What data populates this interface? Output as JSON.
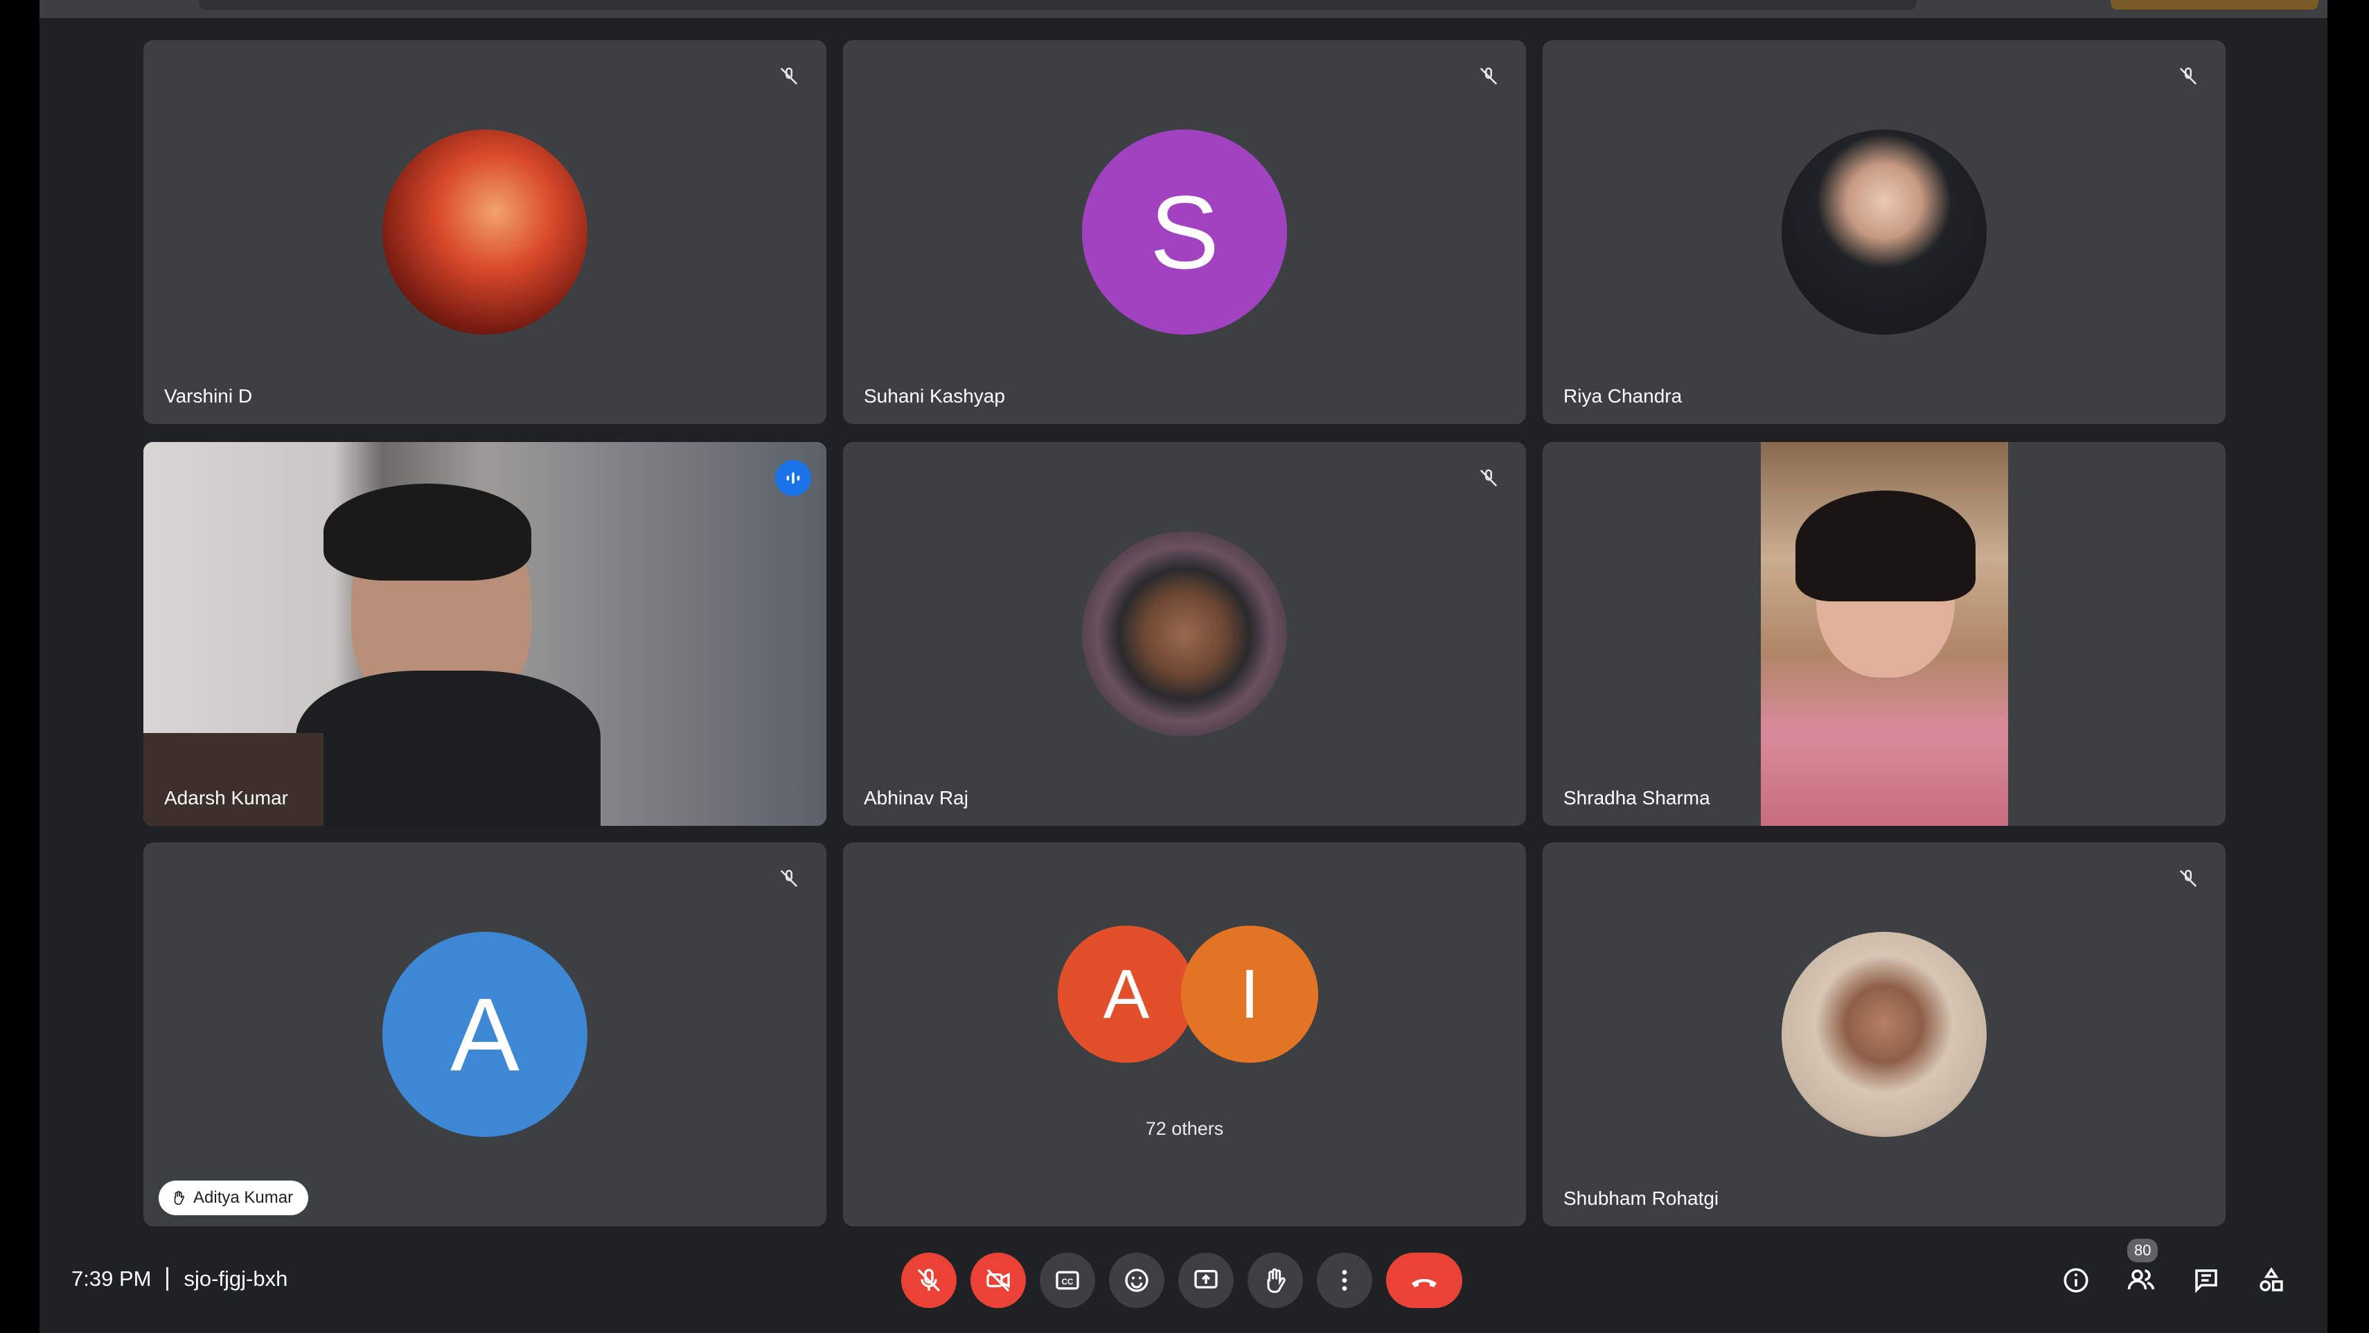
{
  "meeting": {
    "time": "7:39 PM",
    "code": "sjo-fjgj-bxh",
    "participant_count": "80"
  },
  "tiles": [
    {
      "name": "Varshini D",
      "avatar_type": "photo",
      "muted": true
    },
    {
      "name": "Suhani Kashyap",
      "avatar_type": "letter",
      "letter": "S",
      "color": "#a142c1",
      "muted": true
    },
    {
      "name": "Riya Chandra",
      "avatar_type": "photo",
      "muted": true
    },
    {
      "name": "Adarsh Kumar",
      "avatar_type": "video",
      "speaking": true
    },
    {
      "name": "Abhinav Raj",
      "avatar_type": "photo",
      "muted": true
    },
    {
      "name": "Shradha Sharma",
      "avatar_type": "video"
    },
    {
      "name": "Aditya Kumar",
      "avatar_type": "letter",
      "letter": "A",
      "color": "#3d87d4",
      "muted": true,
      "hand_raised": true
    },
    {
      "others_label": "72 others",
      "letters": [
        "A",
        "I"
      ],
      "colors": [
        "#e1502a",
        "#e37424"
      ]
    },
    {
      "name": "Shubham Rohatgi",
      "avatar_type": "photo",
      "muted": true
    }
  ],
  "controls": [
    {
      "icon": "mic-off-icon",
      "state": "off"
    },
    {
      "icon": "camera-off-icon",
      "state": "off"
    },
    {
      "icon": "captions-icon"
    },
    {
      "icon": "emoji-icon"
    },
    {
      "icon": "present-screen-icon"
    },
    {
      "icon": "raise-hand-icon"
    },
    {
      "icon": "more-options-icon"
    },
    {
      "icon": "end-call-icon"
    }
  ],
  "right_controls": [
    {
      "icon": "info-icon"
    },
    {
      "icon": "people-icon"
    },
    {
      "icon": "chat-icon"
    },
    {
      "icon": "activities-icon"
    }
  ],
  "colors": {
    "background": "#202124",
    "tile": "#3c4043",
    "active_border": "#8ab4f8",
    "red": "#ea4335"
  }
}
